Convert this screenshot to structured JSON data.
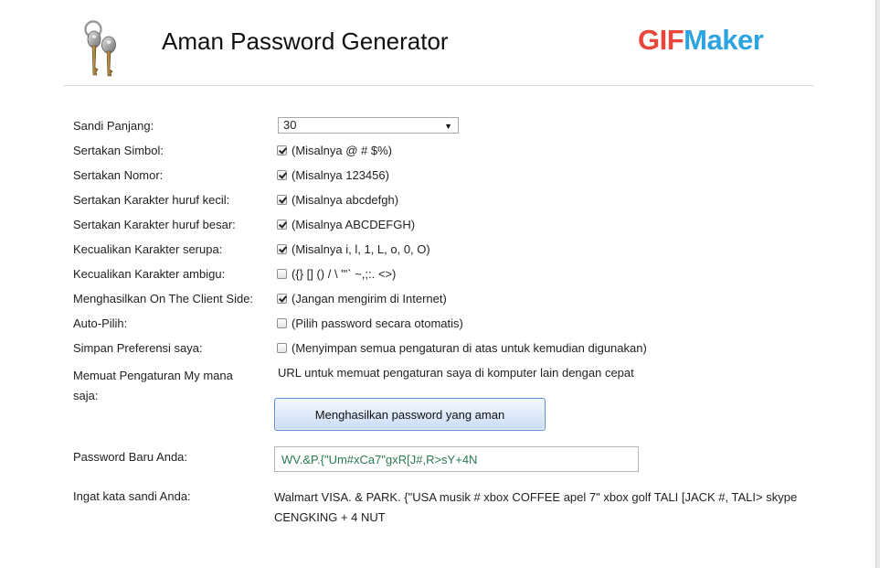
{
  "header": {
    "title": "Aman Password Generator",
    "brand_part1": "GIF",
    "brand_part2": "Maker",
    "logo_icon": "keys-icon",
    "colors": {
      "brand_red": "#e8473c",
      "brand_blue": "#2da3e0"
    }
  },
  "form": {
    "length": {
      "label": "Sandi Panjang:",
      "value": "30"
    },
    "symbols": {
      "label": "Sertakan Simbol:",
      "checked": true,
      "hint": "(Misalnya @ # $%)"
    },
    "numbers": {
      "label": "Sertakan Nomor:",
      "checked": true,
      "hint": "(Misalnya 123456)"
    },
    "lowercase": {
      "label": "Sertakan Karakter huruf kecil:",
      "checked": true,
      "hint": "(Misalnya abcdefgh)"
    },
    "uppercase": {
      "label": "Sertakan Karakter huruf besar:",
      "checked": true,
      "hint": "(Misalnya ABCDEFGH)"
    },
    "similar": {
      "label": "Kecualikan Karakter serupa:",
      "checked": true,
      "hint": "(Misalnya i, l, 1, L, o, 0, O)"
    },
    "ambiguous": {
      "label": "Kecualikan Karakter ambigu:",
      "checked": false,
      "hint": "({} [] () / \\ '\"` ~,;:. <>)"
    },
    "client_side": {
      "label": "Menghasilkan On The Client Side:",
      "checked": true,
      "hint": "(Jangan mengirim di Internet)"
    },
    "auto_select": {
      "label": "Auto-Pilih:",
      "checked": false,
      "hint": "(Pilih password secara otomatis)"
    },
    "save_prefs": {
      "label": "Simpan Preferensi saya:",
      "checked": false,
      "hint": "(Menyimpan semua pengaturan di atas untuk kemudian digunakan)"
    },
    "load_settings": {
      "label_line1": "Memuat Pengaturan My mana",
      "label_line2": "saja:",
      "value": "URL untuk memuat pengaturan saya di komputer lain dengan cepat"
    }
  },
  "generate_button": "Menghasilkan password yang aman",
  "result": {
    "password_label": "Password Baru Anda:",
    "password_value": "WV.&P.{\"Um#xCa7\"gxR[J#,R>sY+4N",
    "mnemonic_label": "Ingat kata sandi Anda:",
    "mnemonic_value": "Walmart VISA. & PARK. {\"USA musik # xbox COFFEE apel 7\" xbox golf TALI [JACK #, TALI> skype CENGKING + 4 NUT"
  }
}
